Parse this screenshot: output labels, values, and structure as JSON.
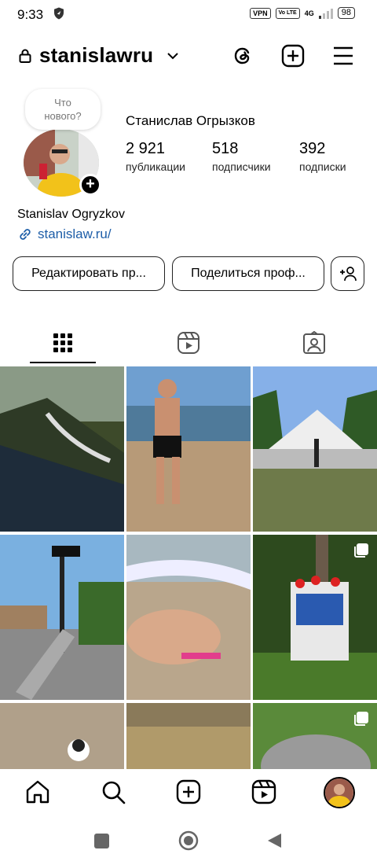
{
  "status_bar": {
    "time": "9:33",
    "vpn": "VPN",
    "volte": "Vo LTE",
    "network": "4G",
    "battery": "98"
  },
  "header": {
    "username": "stanislawru"
  },
  "profile": {
    "bubble_text": "Что нового?",
    "full_name": "Станислав Огрызков",
    "stats": [
      {
        "value": "2 921",
        "label": "публикации"
      },
      {
        "value": "518",
        "label": "подписчики"
      },
      {
        "value": "392",
        "label": "подписки"
      }
    ],
    "bio_name": "Stanislav Ogryzkov",
    "link": "stanislaw.ru/"
  },
  "buttons": {
    "edit": "Редактировать пр...",
    "share": "Поделиться проф..."
  },
  "colors": {
    "link": "#1e5ea8",
    "accent": "#000000"
  }
}
